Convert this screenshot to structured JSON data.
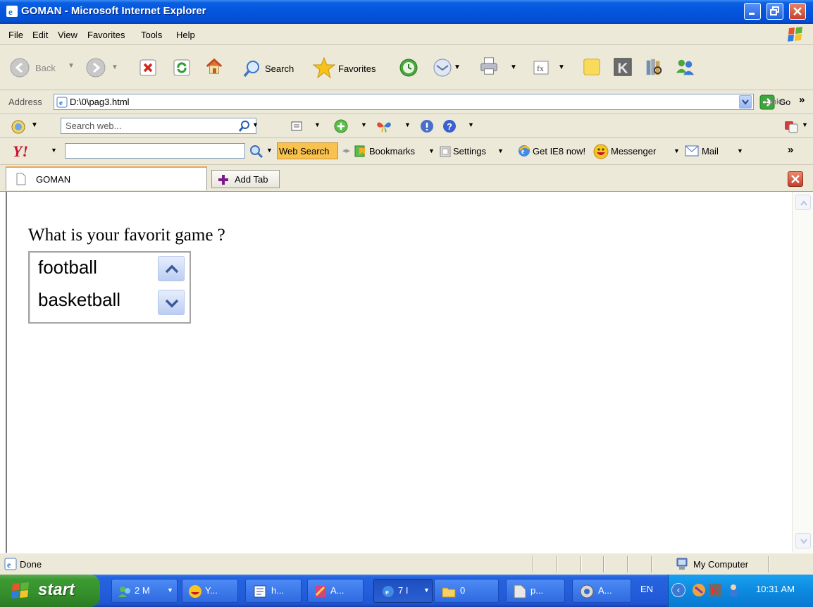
{
  "window": {
    "title": "GOMAN - Microsoft Internet Explorer",
    "icons": [
      "ie-icon",
      "minimize-icon",
      "maximize-icon",
      "close-icon"
    ]
  },
  "menu": {
    "file": "File",
    "edit": "Edit",
    "view": "View",
    "favorites": "Favorites",
    "tools": "Tools",
    "help": "Help"
  },
  "toolbar": {
    "back": "Back",
    "search": "Search",
    "favorites": "Favorites"
  },
  "address": {
    "label": "Address",
    "url": "D:\\0\\pag3.html",
    "go": "Go",
    "links": "Links",
    "chevron": "»"
  },
  "searchbar": {
    "placeholder": "Search web..."
  },
  "yahoo": {
    "logo": "Y!",
    "web_search": "Web Search",
    "bookmarks": "Bookmarks",
    "settings": "Settings",
    "get_ie8": "Get IE8 now!",
    "messenger": "Messenger",
    "mail": "Mail",
    "chevron": "»"
  },
  "tabs": {
    "active_tab": "GOMAN",
    "add_tab": "Add Tab"
  },
  "page": {
    "question": "What is your favorit game ?",
    "options": [
      "football",
      "basketball"
    ]
  },
  "status": {
    "text": "Done",
    "zone": "My Computer"
  },
  "taskbar": {
    "start": "start",
    "tasks": [
      "2 M",
      "Y...",
      "h...",
      "A...",
      "7 I",
      "0",
      "p...",
      "A..."
    ],
    "lang": "EN",
    "clock": "10:31 AM"
  },
  "colors": {
    "titlebar": "#0454dd",
    "chrome": "#ece9d8",
    "taskbar": "#245edc",
    "start": "#358f2c",
    "tray": "#0c8ae0",
    "web_search": "#f9c24f",
    "tab_accent": "#f3a34d"
  }
}
